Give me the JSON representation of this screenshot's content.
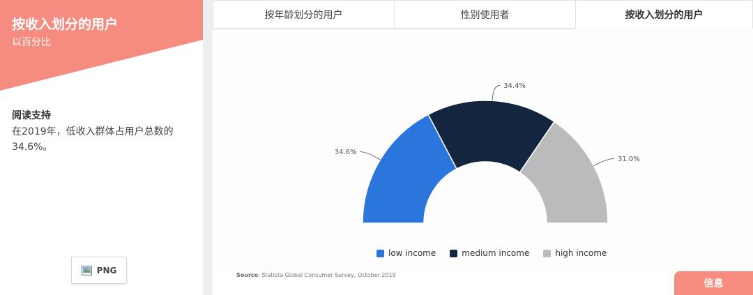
{
  "sidebar": {
    "title": "按收入划分的用户",
    "subtitle": "以百分比",
    "reading_heading": "阅读支持",
    "reading_text": "在2019年，低收入群体占用户总数的34.6%。",
    "png_label": "PNG"
  },
  "tabs": [
    {
      "label": "按年龄划分的用户",
      "active": false
    },
    {
      "label": "性别使用者",
      "active": false
    },
    {
      "label": "按收入划分的用户",
      "active": true
    }
  ],
  "chart_data": {
    "type": "pie",
    "variant": "semi-donut",
    "categories": [
      "low income",
      "medium income",
      "high income"
    ],
    "values": [
      34.6,
      34.4,
      31.0
    ],
    "value_labels": [
      "34.6%",
      "34.4%",
      "31.0%"
    ],
    "colors": [
      "#2a76dd",
      "#14253f",
      "#bbbbbd"
    ],
    "legend_position": "bottom"
  },
  "source": {
    "prefix": "Source",
    "text": ": Statista Global Consumer Survey, October 2019"
  },
  "info_label": "信息",
  "colors": {
    "accent": "#f68c80",
    "divider": "#eceef1"
  }
}
